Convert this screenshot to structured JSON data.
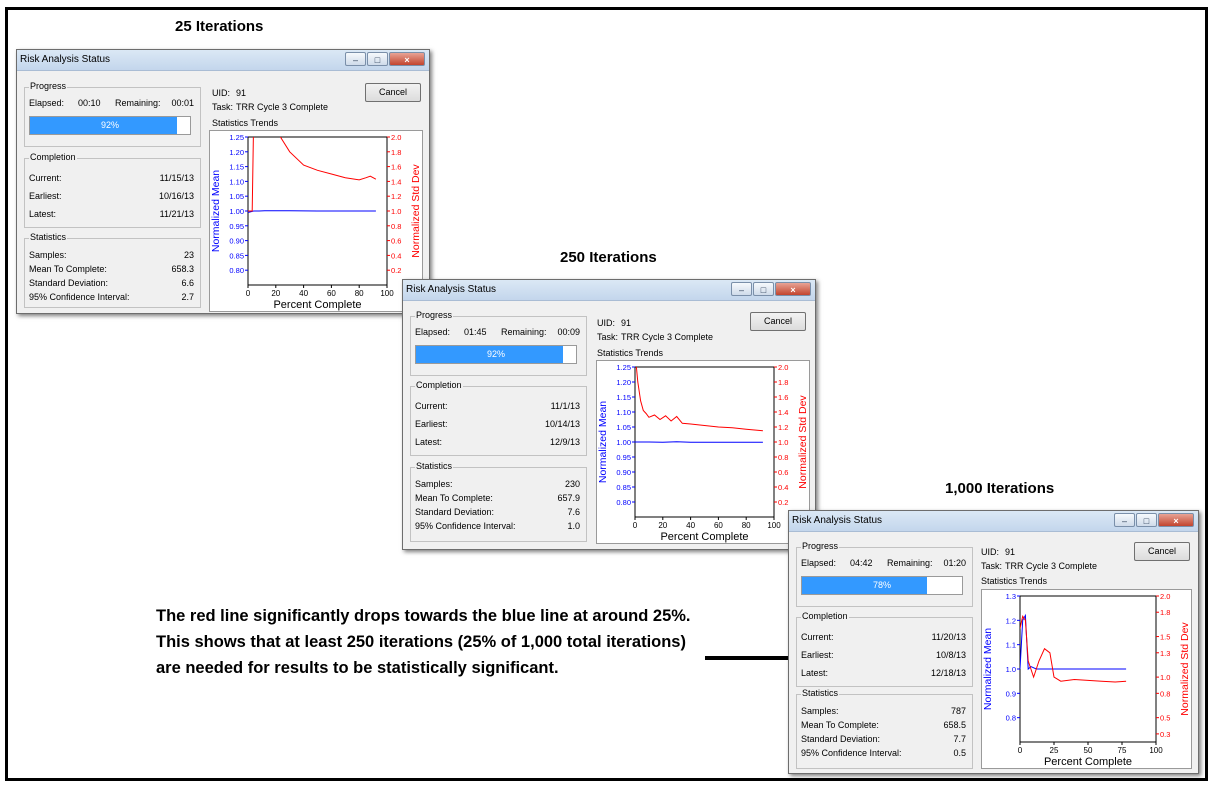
{
  "headings": {
    "first": "25 Iterations",
    "second": "250 Iterations",
    "third": "1,000 Iterations"
  },
  "annotation": "The red line significantly drops towards the blue line at around 25%. This shows that at least 250 iterations (25% of 1,000 total iterations) are needed for results to be statistically significant.",
  "windows": [
    {
      "title": "Risk Analysis Status",
      "progress": {
        "group_label": "Progress",
        "elapsed_label": "Elapsed:",
        "elapsed": "00:10",
        "remaining_label": "Remaining:",
        "remaining": "00:01",
        "percent_text": "92%",
        "fraction": 0.92
      },
      "completion": {
        "group_label": "Completion",
        "current_label": "Current:",
        "current": "11/15/13",
        "earliest_label": "Earliest:",
        "earliest": "10/16/13",
        "latest_label": "Latest:",
        "latest": "11/21/13"
      },
      "statistics": {
        "group_label": "Statistics",
        "samples_label": "Samples:",
        "samples": "23",
        "mean_label": "Mean To Complete:",
        "mean": "658.3",
        "sd_label": "Standard Deviation:",
        "sd": "6.6",
        "ci_label": "95% Confidence Interval:",
        "ci": "2.7"
      },
      "uid_label": "UID:",
      "uid": "91",
      "task_label": "Task:",
      "task": "TRR Cycle 3 Complete",
      "trends_label": "Statistics Trends",
      "cancel_label": "Cancel"
    },
    {
      "title": "Risk Analysis Status",
      "progress": {
        "group_label": "Progress",
        "elapsed_label": "Elapsed:",
        "elapsed": "01:45",
        "remaining_label": "Remaining:",
        "remaining": "00:09",
        "percent_text": "92%",
        "fraction": 0.92
      },
      "completion": {
        "group_label": "Completion",
        "current_label": "Current:",
        "current": "11/1/13",
        "earliest_label": "Earliest:",
        "earliest": "10/14/13",
        "latest_label": "Latest:",
        "latest": "12/9/13"
      },
      "statistics": {
        "group_label": "Statistics",
        "samples_label": "Samples:",
        "samples": "230",
        "mean_label": "Mean To Complete:",
        "mean": "657.9",
        "sd_label": "Standard Deviation:",
        "sd": "7.6",
        "ci_label": "95% Confidence Interval:",
        "ci": "1.0"
      },
      "uid_label": "UID:",
      "uid": "91",
      "task_label": "Task:",
      "task": "TRR Cycle 3 Complete",
      "trends_label": "Statistics Trends",
      "cancel_label": "Cancel"
    },
    {
      "title": "Risk Analysis Status",
      "progress": {
        "group_label": "Progress",
        "elapsed_label": "Elapsed:",
        "elapsed": "04:42",
        "remaining_label": "Remaining:",
        "remaining": "01:20",
        "percent_text": "78%",
        "fraction": 0.78
      },
      "completion": {
        "group_label": "Completion",
        "current_label": "Current:",
        "current": "11/20/13",
        "earliest_label": "Earliest:",
        "earliest": "10/8/13",
        "latest_label": "Latest:",
        "latest": "12/18/13"
      },
      "statistics": {
        "group_label": "Statistics",
        "samples_label": "Samples:",
        "samples": "787",
        "mean_label": "Mean To Complete:",
        "mean": "658.5",
        "sd_label": "Standard Deviation:",
        "sd": "7.7",
        "ci_label": "95% Confidence Interval:",
        "ci": "0.5"
      },
      "uid_label": "UID:",
      "uid": "91",
      "task_label": "Task:",
      "task": "TRR Cycle 3 Complete",
      "trends_label": "Statistics Trends",
      "cancel_label": "Cancel"
    }
  ],
  "colors": {
    "mean_line": "#0000ff",
    "std_line": "#ff0000",
    "progress_fill": "#3399ff"
  },
  "chart_data": [
    {
      "type": "line",
      "xlabel": "Percent Complete",
      "ylabel_left": "Normalized Mean",
      "ylabel_right": "Normalized Std Dev",
      "xlim": [
        0,
        100
      ],
      "ylim_left": [
        0.75,
        1.25
      ],
      "ylim_right": [
        0,
        2.0
      ],
      "x_ticks": [
        "0",
        "20",
        "40",
        "60",
        "80",
        "100"
      ],
      "y_left_ticks": [
        "1.25",
        "1.20",
        "1.15",
        "1.10",
        "1.05",
        "1.00",
        "0.95",
        "0.90",
        "0.85",
        "0.80"
      ],
      "y_right_ticks": [
        "2.0",
        "1.8",
        "1.6",
        "1.4",
        "1.2",
        "1.0",
        "0.8",
        "0.6",
        "0.4",
        "0.2"
      ],
      "series": [
        {
          "name": "Normalized Mean",
          "axis": "left",
          "color": "#0000ff",
          "x": [
            0,
            4,
            8,
            12,
            30,
            50,
            70,
            92
          ],
          "y": [
            0.995,
            1.0,
            1.0,
            1.001,
            1.001,
            1.0,
            1.0,
            1.0
          ]
        },
        {
          "name": "Normalized Std Dev",
          "axis": "right",
          "color": "#ff0000",
          "x": [
            0,
            3,
            4,
            8,
            12,
            20,
            30,
            40,
            50,
            60,
            70,
            80,
            85,
            88,
            92
          ],
          "y": [
            1.0,
            1.0,
            2.2,
            2.5,
            2.3,
            2.1,
            1.8,
            1.62,
            1.55,
            1.5,
            1.45,
            1.42,
            1.45,
            1.47,
            1.43
          ]
        }
      ]
    },
    {
      "type": "line",
      "xlabel": "Percent Complete",
      "ylabel_left": "Normalized Mean",
      "ylabel_right": "Normalized Std Dev",
      "xlim": [
        0,
        100
      ],
      "ylim_left": [
        0.75,
        1.25
      ],
      "ylim_right": [
        0,
        2.0
      ],
      "x_ticks": [
        "0",
        "20",
        "40",
        "60",
        "80",
        "100"
      ],
      "y_left_ticks": [
        "1.25",
        "1.20",
        "1.15",
        "1.10",
        "1.05",
        "1.00",
        "0.95",
        "0.90",
        "0.85",
        "0.80"
      ],
      "y_right_ticks": [
        "2.0",
        "1.8",
        "1.6",
        "1.4",
        "1.2",
        "1.0",
        "0.8",
        "0.6",
        "0.4",
        "0.2"
      ],
      "series": [
        {
          "name": "Normalized Mean",
          "axis": "left",
          "color": "#0000ff",
          "x": [
            0,
            5,
            10,
            20,
            30,
            40,
            60,
            80,
            92
          ],
          "y": [
            1.0,
            1.0,
            1.0,
            0.999,
            1.001,
            0.999,
            0.999,
            0.999,
            0.999
          ]
        },
        {
          "name": "Normalized Std Dev",
          "axis": "right",
          "color": "#ff0000",
          "x": [
            0,
            2,
            4,
            6,
            8,
            10,
            14,
            18,
            22,
            26,
            30,
            34,
            40,
            50,
            60,
            70,
            80,
            92
          ],
          "y": [
            2.2,
            1.8,
            1.55,
            1.42,
            1.38,
            1.33,
            1.36,
            1.3,
            1.35,
            1.28,
            1.34,
            1.25,
            1.24,
            1.22,
            1.2,
            1.19,
            1.17,
            1.15
          ]
        }
      ]
    },
    {
      "type": "line",
      "xlabel": "Percent Complete",
      "ylabel_left": "Normalized Mean",
      "ylabel_right": "Normalized Std Dev",
      "xlim": [
        0,
        100
      ],
      "ylim_left": [
        0.7,
        1.3
      ],
      "ylim_right": [
        0.2,
        2.0
      ],
      "x_ticks": [
        "0",
        "25",
        "50",
        "75",
        "100"
      ],
      "y_left_ticks": [
        "1.3",
        "1.2",
        "1.1",
        "1.0",
        "0.9",
        "0.8"
      ],
      "y_right_ticks": [
        "2.0",
        "1.8",
        "1.5",
        "1.3",
        "1.0",
        "0.8",
        "0.5",
        "0.3"
      ],
      "series": [
        {
          "name": "Normalized Mean",
          "axis": "left",
          "color": "#0000ff",
          "x": [
            0,
            2,
            4,
            6,
            8,
            12,
            20,
            40,
            60,
            78
          ],
          "y": [
            1.0,
            1.2,
            1.22,
            1.0,
            1.01,
            1.0,
            1.0,
            1.0,
            1.0,
            1.0
          ]
        },
        {
          "name": "Normalized Std Dev",
          "axis": "right",
          "color": "#ff0000",
          "x": [
            0,
            2,
            4,
            6,
            10,
            14,
            18,
            22,
            25,
            30,
            40,
            50,
            60,
            70,
            78
          ],
          "y": [
            1.6,
            1.75,
            1.7,
            1.2,
            1.0,
            1.2,
            1.35,
            1.3,
            1.0,
            0.95,
            0.97,
            0.96,
            0.95,
            0.94,
            0.95
          ]
        }
      ]
    }
  ]
}
